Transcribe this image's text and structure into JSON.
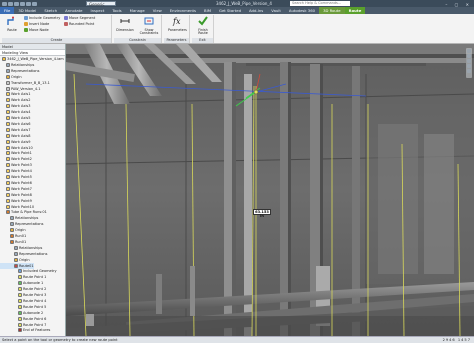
{
  "titlebar": {
    "project": "Generic",
    "title": "3462_J_WeB_Pipe_Version_4",
    "search_placeholder": "Search Help & Commands...",
    "window_controls": "– ▢ ✕"
  },
  "tabs": [
    "File",
    "3D Model",
    "Sketch",
    "Annotate",
    "Inspect",
    "Tools",
    "Manage",
    "View",
    "Environments",
    "BIM",
    "Get Started",
    "Add-Ins",
    "Vault",
    "Autodesk 360",
    "3D Route",
    "Route"
  ],
  "ribbon": {
    "groups": [
      {
        "label": "Create",
        "items": [
          "Route",
          "Include Geometry",
          "Insert Node",
          "Move Segment",
          "Insert Fitting",
          "Rounded Point",
          "Move Node",
          "Auto Route"
        ]
      },
      {
        "label": "Constrain",
        "items": [
          "Dimension",
          "Show Constraints"
        ]
      },
      {
        "label": "Parameters",
        "items": [
          "Parameters"
        ]
      },
      {
        "label": "Exit",
        "items": [
          "Finish Route"
        ]
      }
    ]
  },
  "model_panel": {
    "header": "Model",
    "view": "Modeling View",
    "items": [
      "3462_J_WeB_Pipe_Version_4.iam",
      "Relationships",
      "Representations",
      "Origin",
      "Transformer_B_B_13.1",
      "PAW_Version_4.1",
      "Work Axis1",
      "Work Axis2",
      "Work Axis3",
      "Work Axis4",
      "Work Axis5",
      "Work Axis6",
      "Work Axis7",
      "Work Axis8",
      "Work Axis9",
      "Work Axis10",
      "Work Point1",
      "Work Point2",
      "Work Point3",
      "Work Point4",
      "Work Point5",
      "Work Point6",
      "Work Point7",
      "Work Point8",
      "Work Point9",
      "Work Point10",
      "Tube & Pipe Runs:01",
      "Relationships",
      "Representations",
      "Origin",
      "Run01",
      "Run01",
      "Relationships",
      "Representations",
      "Origin",
      "Route01",
      "Included Geometry",
      "Route Point 1",
      "Autonode 1",
      "Route Point 2",
      "Route Point 3",
      "Route Point 4",
      "Route Point 5",
      "Autonode 2",
      "Route Point 6",
      "Route Point 7",
      "End of Features"
    ]
  },
  "viewport": {
    "dimension_value": "63.153 in"
  },
  "status": {
    "message": "Select a point on the tool or geometry to create new route point",
    "counts": "2946   1457"
  }
}
